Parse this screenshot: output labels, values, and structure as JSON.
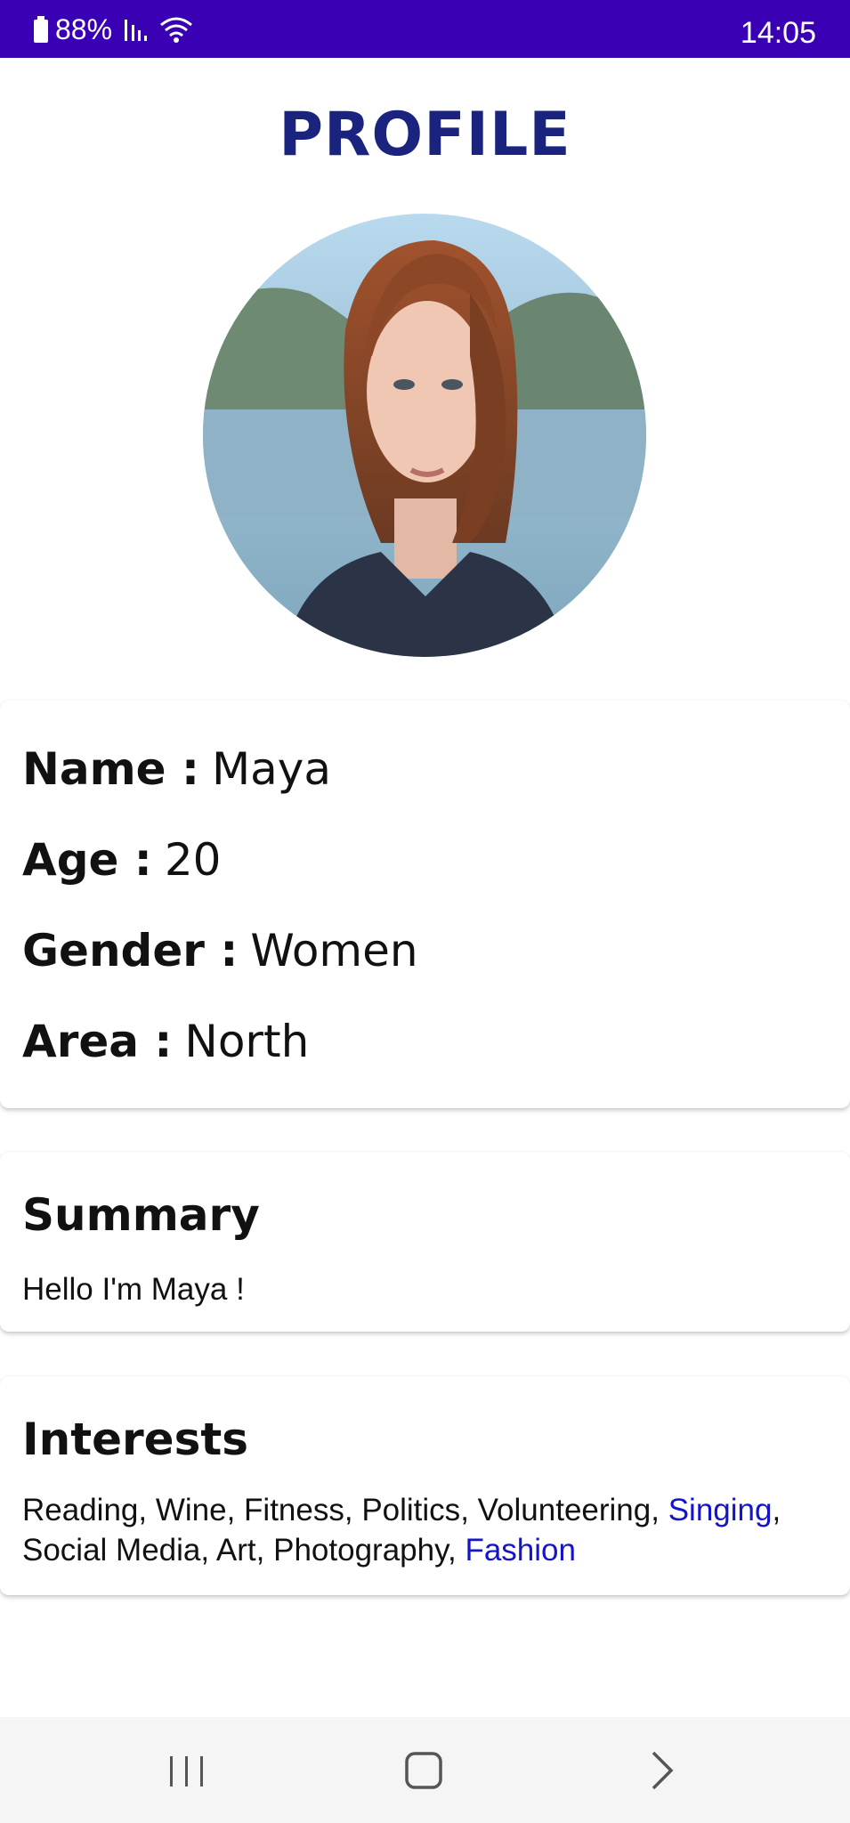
{
  "status_bar": {
    "battery": "88%",
    "time": "14:05"
  },
  "header": {
    "title": "PROFILE"
  },
  "profile": {
    "fields": [
      {
        "key": "Name :",
        "value": "Maya"
      },
      {
        "key": "Age :",
        "value": "20"
      },
      {
        "key": "Gender :",
        "value": "Women"
      },
      {
        "key": "Area :",
        "value": "North"
      }
    ]
  },
  "summary": {
    "heading": "Summary",
    "text": "Hello I'm Maya !"
  },
  "interests": {
    "heading": "Interests",
    "items": [
      {
        "label": "Reading",
        "highlighted": false
      },
      {
        "label": "Wine",
        "highlighted": false
      },
      {
        "label": "Fitness",
        "highlighted": false
      },
      {
        "label": "Politics",
        "highlighted": false
      },
      {
        "label": "Volunteering",
        "highlighted": false
      },
      {
        "label": "Singing",
        "highlighted": true
      },
      {
        "label": "Social Media",
        "highlighted": false
      },
      {
        "label": "Art",
        "highlighted": false
      },
      {
        "label": "Photography",
        "highlighted": false
      },
      {
        "label": "Fashion",
        "highlighted": true
      }
    ]
  },
  "colors": {
    "status_bar": "#3a00b3",
    "title": "#1a237e",
    "highlight": "#1515c8"
  },
  "icons": [
    "battery-icon",
    "signal-icon",
    "wifi-icon",
    "recent-apps-icon",
    "home-icon",
    "back-icon"
  ]
}
